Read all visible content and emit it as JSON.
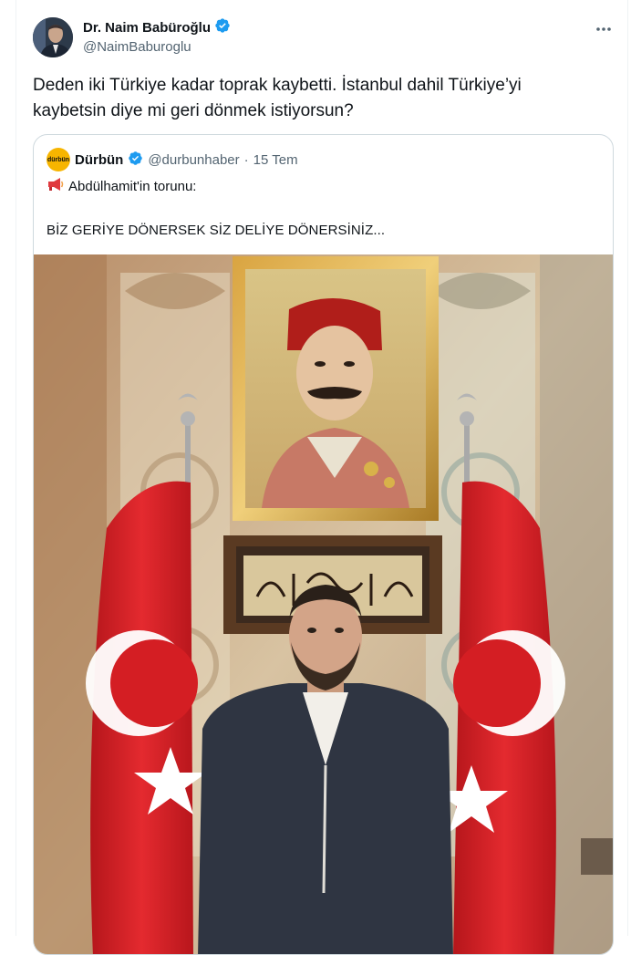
{
  "author": {
    "name": "Dr. Naim Babüroğlu",
    "handle": "@NaimBaburoglu",
    "verified": true
  },
  "tweet": {
    "text": "Deden iki Türkiye kadar toprak kaybetti. İstanbul dahil Türkiye’yi kaybetsin diye mi geri dönmek istiyorsun?"
  },
  "quoted": {
    "logo_text": "dürbün",
    "name": "Dürbün",
    "handle": "@durbunhaber",
    "separator": "·",
    "date": "15 Tem",
    "line1": "Abdülhamit'in torunu:",
    "line2": "BİZ GERİYE DÖNERSEK SİZ DELİYE DÖNERSİNİZ..."
  },
  "colors": {
    "verified_blue": "#1d9bf0",
    "secondary_text": "#536471",
    "flag_red": "#d41e23"
  }
}
